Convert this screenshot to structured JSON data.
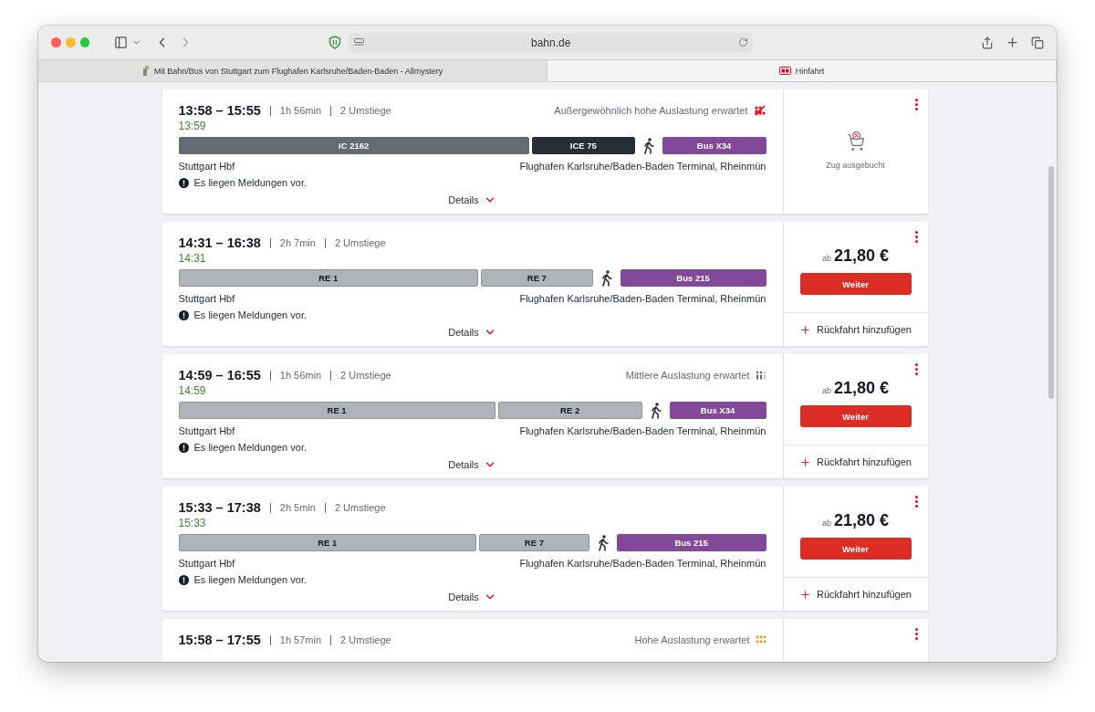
{
  "browser": {
    "url": "bahn.de",
    "tabs": [
      {
        "title": "Mit Bahn/Bus von Stuttgart zum Flughafen Karlsruhe/Baden-Baden - Allmystery",
        "kind": "forum",
        "selected": false
      },
      {
        "title": "Hinfahrt",
        "kind": "db",
        "selected": true
      }
    ]
  },
  "connections": [
    {
      "times": "13:58 – 15:55",
      "duration": "1h 56min",
      "transfers": "2 Umstiege",
      "actual_time": "13:59",
      "load": {
        "text": "Außergewöhnlich hohe Auslastung erwartet",
        "kind": "exceptional"
      },
      "segments": [
        {
          "label": "IC 2162",
          "kind": "ic"
        },
        {
          "label": "ICE 75",
          "kind": "ice"
        },
        {
          "kind": "walk"
        },
        {
          "label": "Bus X34",
          "kind": "bus"
        }
      ],
      "from": "Stuttgart Hbf",
      "to": "Flughafen Karlsruhe/Baden-Baden Terminal, Rheinmün",
      "notice": "Es liegen Meldungen vor.",
      "details": "Details",
      "offer": {
        "kind": "booked_out",
        "text": "Zug ausgebucht"
      }
    },
    {
      "times": "14:31 – 16:38",
      "duration": "2h 7min",
      "transfers": "2 Umstiege",
      "actual_time": "14:31",
      "segments": [
        {
          "label": "RE 1",
          "kind": "regional"
        },
        {
          "label": "RE 7",
          "kind": "regional"
        },
        {
          "kind": "walk"
        },
        {
          "label": "Bus 215",
          "kind": "bus"
        }
      ],
      "from": "Stuttgart Hbf",
      "to": "Flughafen Karlsruhe/Baden-Baden Terminal, Rheinmün",
      "notice": "Es liegen Meldungen vor.",
      "details": "Details",
      "offer": {
        "kind": "price",
        "prefix": "ab",
        "price": "21,80 €",
        "button": "Weiter",
        "return_link": "Rückfahrt hinzufügen"
      }
    },
    {
      "times": "14:59 – 16:55",
      "duration": "1h 56min",
      "transfers": "2 Umstiege",
      "actual_time": "14:59",
      "load": {
        "text": "Mittlere Auslastung erwartet",
        "kind": "medium"
      },
      "segments": [
        {
          "label": "RE 1",
          "kind": "regional"
        },
        {
          "label": "RE 2",
          "kind": "regional"
        },
        {
          "kind": "walk"
        },
        {
          "label": "Bus X34",
          "kind": "bus"
        }
      ],
      "from": "Stuttgart Hbf",
      "to": "Flughafen Karlsruhe/Baden-Baden Terminal, Rheinmün",
      "notice": "Es liegen Meldungen vor.",
      "details": "Details",
      "offer": {
        "kind": "price",
        "prefix": "ab",
        "price": "21,80 €",
        "button": "Weiter",
        "return_link": "Rückfahrt hinzufügen"
      }
    },
    {
      "times": "15:33 – 17:38",
      "duration": "2h 5min",
      "transfers": "2 Umstiege",
      "actual_time": "15:33",
      "segments": [
        {
          "label": "RE 1",
          "kind": "regional"
        },
        {
          "label": "RE 7",
          "kind": "regional"
        },
        {
          "kind": "walk"
        },
        {
          "label": "Bus 215",
          "kind": "bus"
        }
      ],
      "from": "Stuttgart Hbf",
      "to": "Flughafen Karlsruhe/Baden-Baden Terminal, Rheinmün",
      "notice": "Es liegen Meldungen vor.",
      "details": "Details",
      "offer": {
        "kind": "price",
        "prefix": "ab",
        "price": "21,80 €",
        "button": "Weiter",
        "return_link": "Rückfahrt hinzufügen"
      }
    },
    {
      "times": "15:58 – 17:55",
      "duration": "1h 57min",
      "transfers": "2 Umstiege",
      "load": {
        "text": "Hohe Auslastung erwartet",
        "kind": "high"
      },
      "offer": {
        "kind": "empty"
      }
    }
  ]
}
